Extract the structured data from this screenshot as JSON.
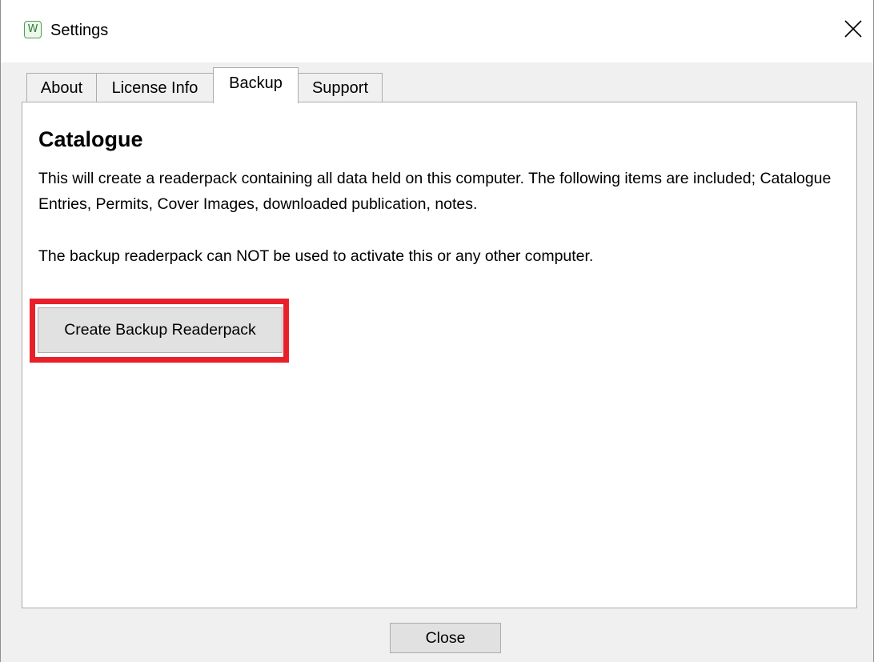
{
  "window": {
    "app_icon_letter": "W",
    "title": "Settings"
  },
  "tabs": [
    {
      "label": "About",
      "active": false
    },
    {
      "label": "License Info",
      "active": false
    },
    {
      "label": "Backup",
      "active": true
    },
    {
      "label": "Support",
      "active": false
    }
  ],
  "backup": {
    "section_title": "Catalogue",
    "description": "This will create a readerpack containing all data held on this computer. The following items are included; Catalogue Entries, Permits, Cover Images, downloaded publication, notes.",
    "note": "The backup readerpack can NOT be used to activate this or any other computer.",
    "button_label": "Create Backup Readerpack"
  },
  "footer": {
    "close_label": "Close"
  },
  "colors": {
    "highlight": "#e8202a",
    "app_icon": "#4aa150"
  }
}
